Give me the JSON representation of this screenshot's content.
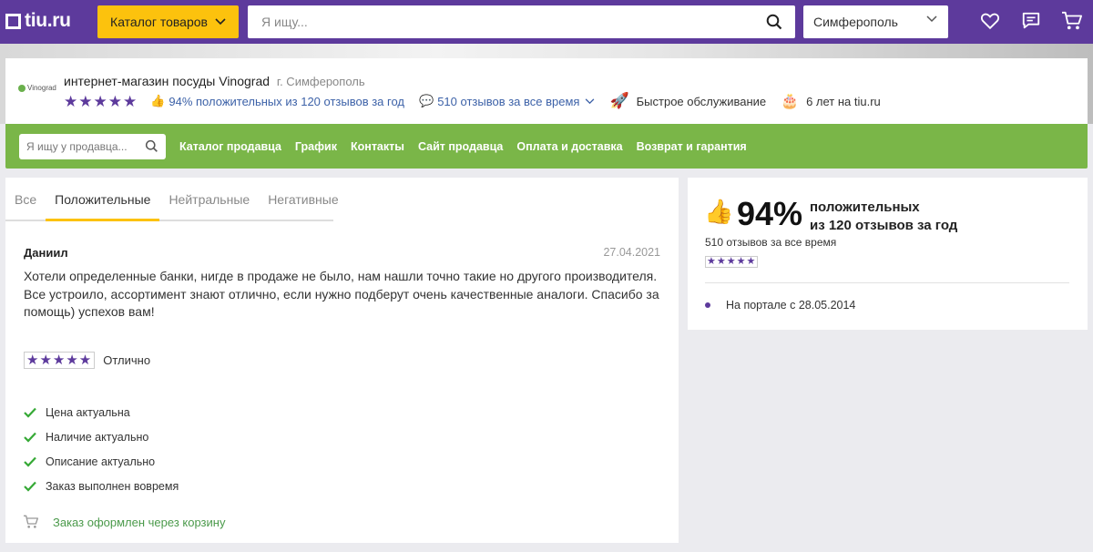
{
  "header": {
    "logo_text": "tiu.ru",
    "catalog_label": "Каталог товаров",
    "search_placeholder": "Я ищу...",
    "city": "Симферополь",
    "icons": [
      "heart-icon",
      "chat-icon",
      "cart-icon"
    ],
    "accent_color": "#5d3a9c",
    "catalog_color": "#fcc20d"
  },
  "seller": {
    "logo_text": "Vinograd",
    "name": "интернет-магазин посуды Vinograd",
    "city": "г. Симферополь",
    "stars": "★★★★★",
    "positive_summary": "94% положительных из 120 отзывов за год",
    "all_time": "510 отзывов за все время",
    "fast_service": "Быстрое обслуживание",
    "years": "6 лет на tiu.ru"
  },
  "seller_nav": {
    "search_placeholder": "Я ищу у продавца...",
    "links": [
      "Каталог продавца",
      "График",
      "Контакты",
      "Сайт продавца",
      "Оплата и доставка",
      "Возврат и гарантия"
    ],
    "color": "#7ab648"
  },
  "tabs": [
    {
      "label": "Все",
      "active": false
    },
    {
      "label": "Положительные",
      "active": true
    },
    {
      "label": "Нейтральные",
      "active": false
    },
    {
      "label": "Негативные",
      "active": false
    }
  ],
  "review": {
    "author": "Даниил",
    "date": "27.04.2021",
    "text": "Хотели определенные банки, нигде в продаже не было, нам нашли точно такие но другого производителя. Все устроило, ассортимент знают отлично, если нужно подберут очень качественные аналоги. Спасибо за помощь) успехов вам!",
    "stars": "★★★★★",
    "rating_label": "Отлично",
    "checks": [
      "Цена актуальна",
      "Наличие актуально",
      "Описание актуально",
      "Заказ выполнен вовремя"
    ],
    "order_note": "Заказ оформлен через корзину"
  },
  "summary": {
    "percent": "94%",
    "line1": "положительных",
    "line2": "из 120 отзывов за год",
    "all_time": "510 отзывов за все время",
    "stars": "★★★★★",
    "portal_since": "На портале с 28.05.2014"
  }
}
